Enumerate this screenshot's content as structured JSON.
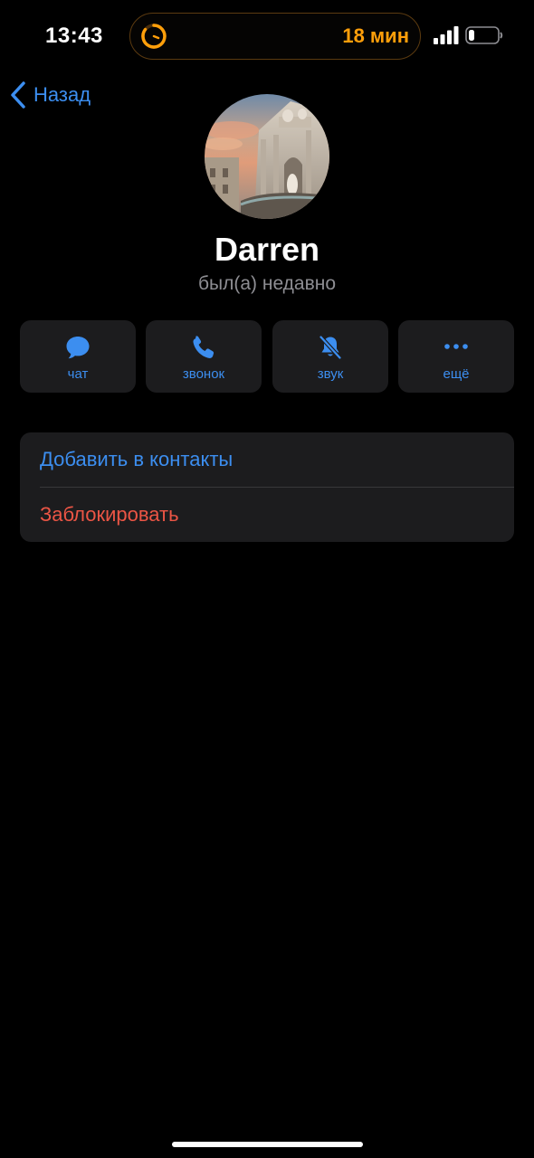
{
  "status_bar": {
    "time": "13:43",
    "timer_text": "18 мин",
    "accent_color": "#ff9f0a",
    "signal_icon": "cellular-signal-icon",
    "battery_icon": "battery-low-icon"
  },
  "nav": {
    "back_label": "Назад",
    "back_icon": "chevron-left-icon"
  },
  "profile": {
    "name": "Darren",
    "last_seen": "был(а) недавно",
    "avatar": "photo of a fountain at sunset"
  },
  "actions": [
    {
      "label": "чат",
      "icon": "chat-bubble-icon"
    },
    {
      "label": "звонок",
      "icon": "phone-icon"
    },
    {
      "label": "звук",
      "icon": "bell-muted-icon"
    },
    {
      "label": "ещё",
      "icon": "more-dots-icon"
    }
  ],
  "menu": {
    "add_to_contacts": "Добавить в контакты",
    "block": "Заблокировать"
  },
  "colors": {
    "background": "#000000",
    "surface": "#1c1c1e",
    "accent_blue": "#3c8ef0",
    "destructive_red": "#eb5545",
    "secondary_text": "#8e8e93"
  }
}
